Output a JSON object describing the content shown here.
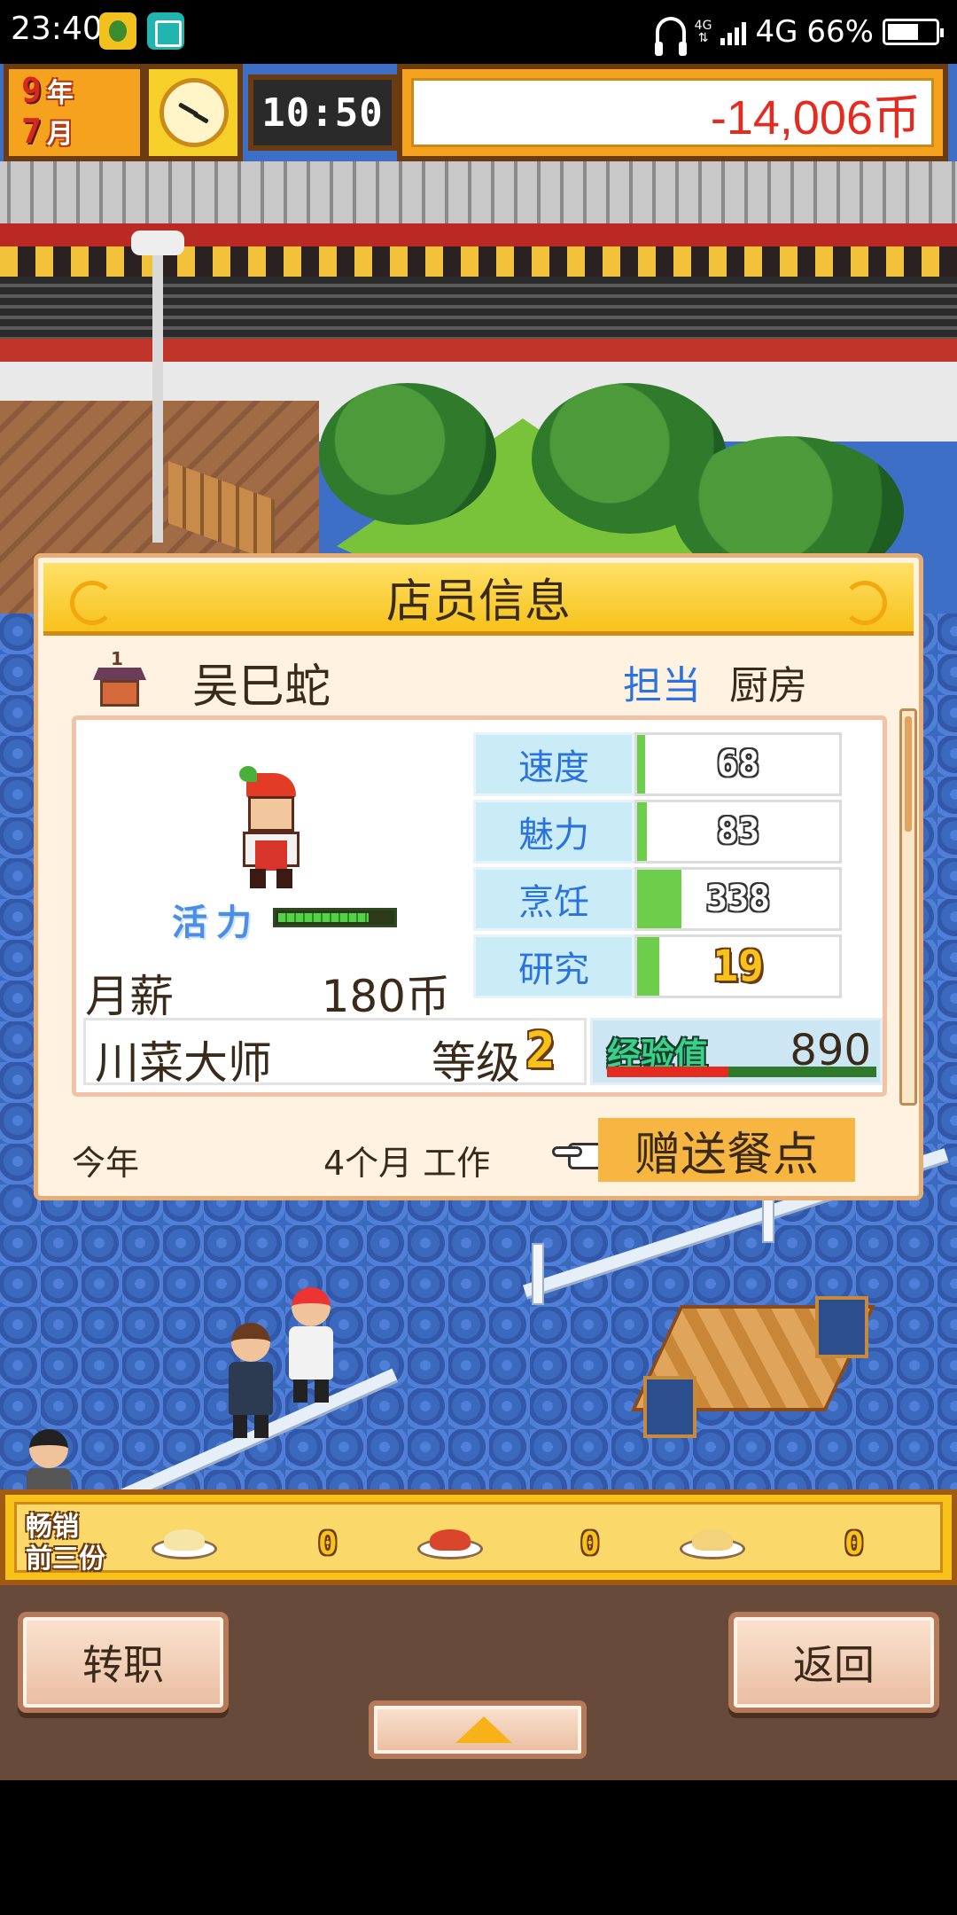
{
  "status_bar": {
    "time": "23:40",
    "network_small": "4G",
    "network": "4G",
    "battery": "66%",
    "battery_level": 0.66
  },
  "hud": {
    "year_num": "9",
    "year_unit": "年",
    "month_num": "7",
    "month_unit": "月",
    "time": "10:50",
    "money": "-14,006币"
  },
  "dialog": {
    "title": "店员信息",
    "shop_level": "1",
    "name": "吴巳蛇",
    "assign_label": "担当",
    "assign_value": "厨房",
    "vitality_label": "活力",
    "vitality_level": 0.8,
    "salary_label": "月薪",
    "salary_value": "180币",
    "stats": [
      {
        "label": "速度",
        "value": "68",
        "fill": 0.04
      },
      {
        "label": "魅力",
        "value": "83",
        "fill": 0.05
      },
      {
        "label": "烹饪",
        "value": "338",
        "fill": 0.22
      },
      {
        "label": "研究",
        "value": "19",
        "fill": 0.11
      }
    ],
    "rank_title": "川菜大师",
    "level_label": "等级",
    "level_value": "2",
    "exp_label": "经验值",
    "exp_value": "890",
    "exp_progress": 0.45,
    "year_label": "今年",
    "work_text": "4个月 工作",
    "gift_button": "赠送餐点"
  },
  "best_sellers": {
    "label_line1": "畅销",
    "label_line2": "前三份",
    "items": [
      {
        "dish": "dish-1",
        "count": "0",
        "color": "#f5e6a8"
      },
      {
        "dish": "dish-2",
        "count": "0",
        "color": "#d9452a"
      },
      {
        "dish": "dish-3",
        "count": "0",
        "color": "#f2d27a"
      }
    ]
  },
  "buttons": {
    "change_job": "转职",
    "back": "返回"
  }
}
